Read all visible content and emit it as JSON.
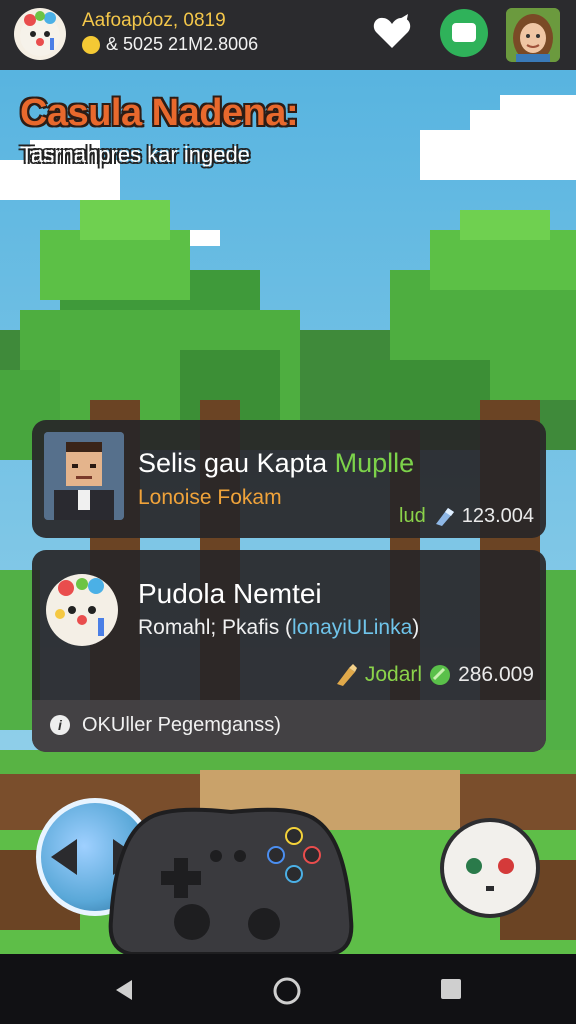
{
  "header": {
    "title": "Aafoapóoz, 0819",
    "currency": "& 5025 21M2.8006"
  },
  "game": {
    "title": "Casula Nadena:",
    "subtitle": "Tasrnahpres kar ingede"
  },
  "card1": {
    "name": "Selis gau Kapta",
    "name_highlight": "Muplle",
    "subtitle": "Lonoise Fokam",
    "stat_label": "lud",
    "stat_value": "123.004"
  },
  "card2": {
    "name": "Pudola Nemtei",
    "subtitle": "Romahl; Pkafis (",
    "subtitle_highlight": "lonayiULinka",
    "subtitle_end": ")",
    "stat_label": "Jodarl",
    "stat_value": "286.009",
    "footer_text": "OKUller Pegemganss)"
  },
  "colors": {
    "accent_orange": "#e8692d",
    "accent_green": "#7cd24a",
    "card_bg": "#282628"
  }
}
